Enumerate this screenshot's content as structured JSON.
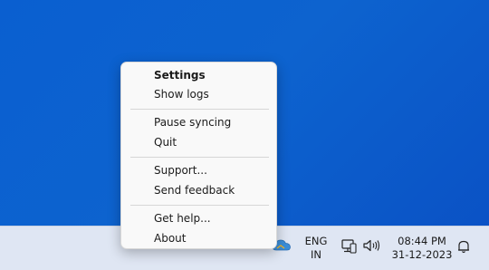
{
  "menu": {
    "items": [
      {
        "label": "Settings"
      },
      {
        "label": "Show logs"
      },
      {
        "label": "Pause syncing"
      },
      {
        "label": "Quit"
      },
      {
        "label": "Support..."
      },
      {
        "label": "Send feedback"
      },
      {
        "label": "Get help..."
      },
      {
        "label": "About"
      }
    ]
  },
  "taskbar": {
    "lang_line1": "ENG",
    "lang_line2": "IN",
    "time": "08:44 PM",
    "date": "31-12-2023",
    "icons": [
      "cloud-sync-icon",
      "network-icon",
      "volume-icon",
      "notification-bell-icon"
    ]
  },
  "colors": {
    "desktop": "#0a5fd0",
    "taskbar": "#dfe6f3",
    "menu_bg": "#f9f9f9"
  }
}
